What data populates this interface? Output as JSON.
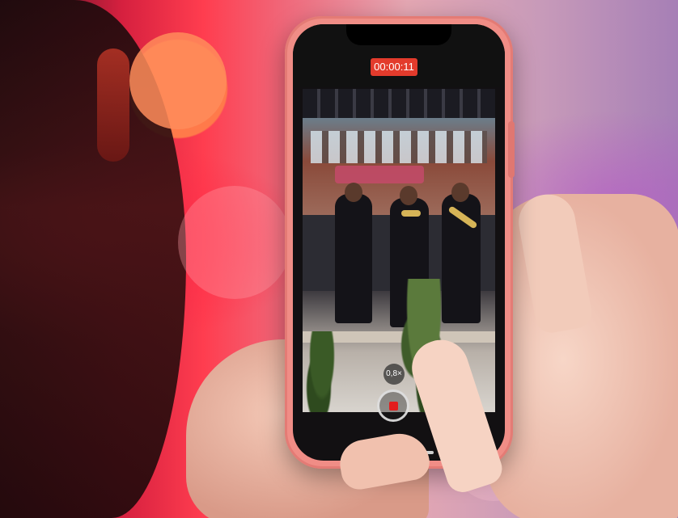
{
  "camera_ui": {
    "recording_timer": "00:00:11",
    "zoom_level": "0,8×"
  },
  "icons": {
    "record_stop": "stop-square-icon"
  },
  "colors": {
    "timer_background": "#e33b2c",
    "stop_button": "#e31d1d",
    "phone_case": "#f08d86"
  }
}
